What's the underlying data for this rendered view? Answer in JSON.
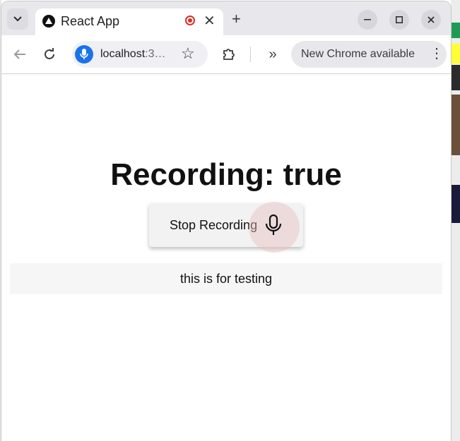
{
  "browser": {
    "tab": {
      "title": "React App",
      "recording_indicator": "recording-dot-icon"
    },
    "address": {
      "host": "localhost",
      "rest": ":3…"
    },
    "update_pill": {
      "label": "New Chrome available"
    }
  },
  "page": {
    "heading": "Recording: true",
    "button": {
      "label": "Stop Recording",
      "icon": "microphone-icon"
    },
    "transcript": "this is for testing"
  },
  "colors": {
    "accent": "#1a73e8",
    "recording": "#d93025",
    "ripple": "#f1d4d4"
  }
}
